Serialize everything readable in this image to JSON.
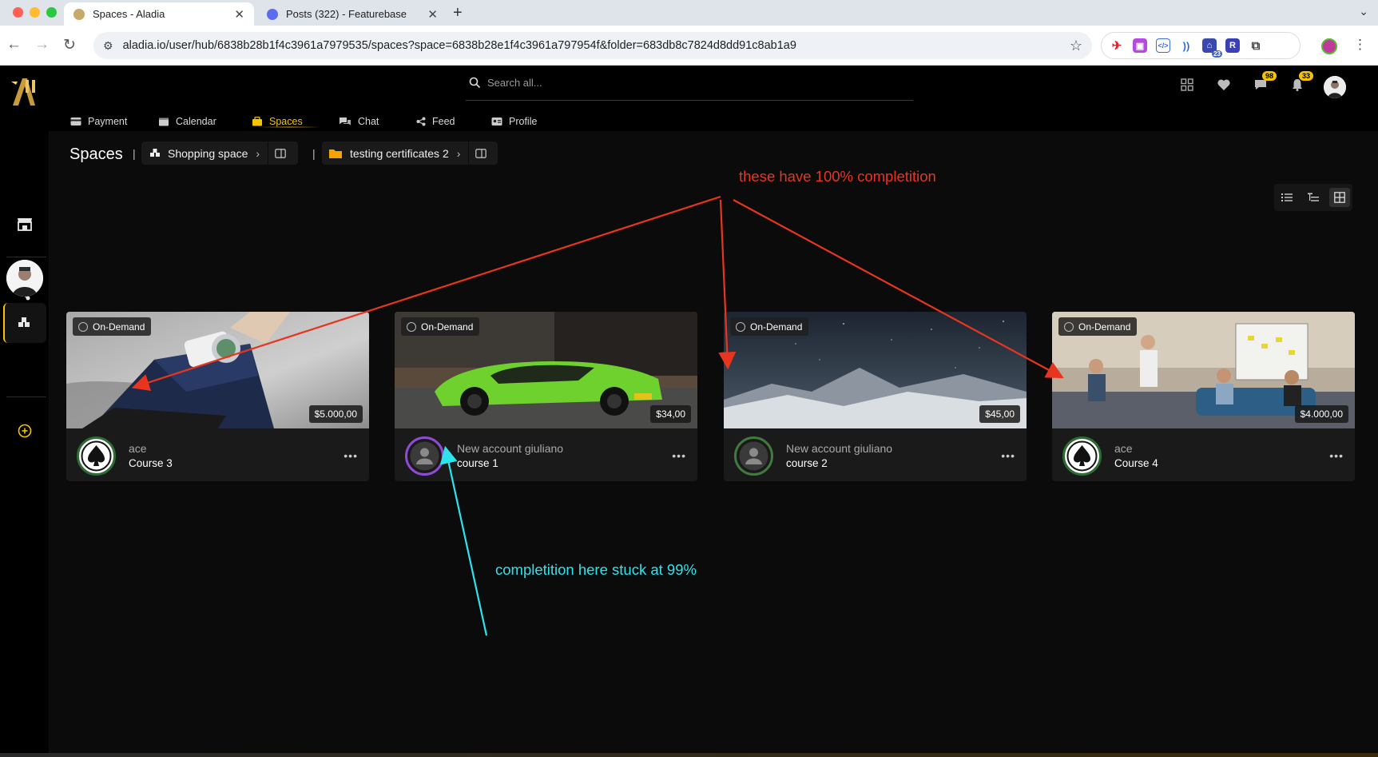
{
  "browser": {
    "tabs": [
      {
        "title": "Spaces - Aladia",
        "active": true
      },
      {
        "title": "Posts (322) - Featurebase",
        "active": false
      }
    ],
    "url": "aladia.io/user/hub/6838b28b1f4c3961a7979535/spaces?space=6838b28e1f4c3961a797954f&folder=683db8c7824d8dd91c8ab1a9",
    "extension_badge": "23"
  },
  "header": {
    "search_placeholder": "Search all...",
    "messages_badge": "98",
    "notifications_badge": "33"
  },
  "nav": {
    "items": [
      {
        "label": "Payment",
        "icon": "credit-card-icon"
      },
      {
        "label": "Calendar",
        "icon": "calendar-icon"
      },
      {
        "label": "Spaces",
        "icon": "spaces-icon",
        "active": true
      },
      {
        "label": "Chat",
        "icon": "chat-icon"
      },
      {
        "label": "Feed",
        "icon": "share-icon"
      },
      {
        "label": "Profile",
        "icon": "id-card-icon"
      }
    ]
  },
  "page": {
    "title": "Spaces",
    "breadcrumb": [
      {
        "label": "Shopping space",
        "icon": "cubes-icon"
      },
      {
        "label": "testing certificates 2",
        "icon": "folder-icon"
      }
    ]
  },
  "cards": [
    {
      "badge": "On-Demand",
      "price": "$5.000,00",
      "owner": "ace",
      "course": "Course 3",
      "avatar": "ace-logo",
      "ring": "#2e6b35"
    },
    {
      "badge": "On-Demand",
      "price": "$34,00",
      "owner": "New account giuliano",
      "course": "course 1",
      "avatar": "user-placeholder",
      "ring": "#8f4ad6"
    },
    {
      "badge": "On-Demand",
      "price": "$45,00",
      "owner": "New account giuliano",
      "course": "course 2",
      "avatar": "user-placeholder",
      "ring": "#3f7a3f"
    },
    {
      "badge": "On-Demand",
      "price": "$4.000,00",
      "owner": "ace",
      "course": "Course 4",
      "avatar": "ace-logo",
      "ring": "#2e6b35"
    }
  ],
  "annotations": {
    "red_text": "these have 100% completition",
    "cyan_text": "completition here stuck at 99%",
    "red_color": "#e8351f",
    "cyan_color": "#2fe3ec"
  },
  "colors": {
    "accent": "#f5c400",
    "background": "#0b0b0b",
    "card": "#1a1a1a"
  }
}
